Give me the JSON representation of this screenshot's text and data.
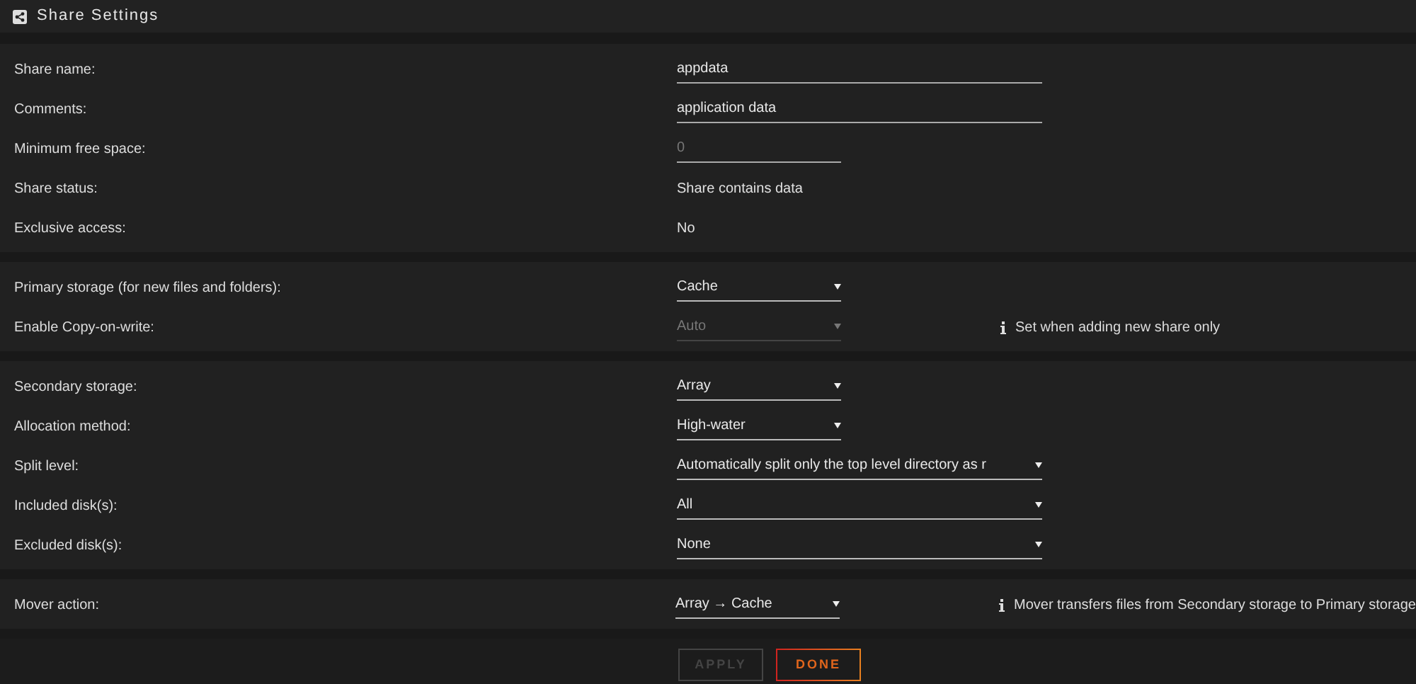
{
  "header": {
    "title": "Share Settings"
  },
  "sections": [
    {
      "rows": [
        {
          "label": "Share name:",
          "kind": "text",
          "value": "appdata",
          "wide": true
        },
        {
          "label": "Comments:",
          "kind": "text",
          "value": "application data",
          "wide": true
        },
        {
          "label": "Minimum free space:",
          "kind": "text",
          "placeholder": "0",
          "wide": false
        },
        {
          "label": "Share status:",
          "kind": "static",
          "value": "Share contains data"
        },
        {
          "label": "Exclusive access:",
          "kind": "static",
          "value": "No"
        }
      ]
    },
    {
      "rows": [
        {
          "label": "Primary storage (for new files and folders):",
          "kind": "select",
          "value": "Cache",
          "wide": false,
          "disabled": false
        },
        {
          "label": "Enable Copy-on-write:",
          "kind": "select",
          "value": "Auto",
          "wide": false,
          "disabled": true,
          "info": "Set when adding new share only"
        }
      ]
    },
    {
      "rows": [
        {
          "label": "Secondary storage:",
          "kind": "select",
          "value": "Array",
          "wide": false,
          "disabled": false
        },
        {
          "label": "Allocation method:",
          "kind": "select",
          "value": "High-water",
          "wide": false,
          "disabled": false
        },
        {
          "label": "Split level:",
          "kind": "select",
          "value": "Automatically split only the top level directory as r",
          "wide": true,
          "disabled": false
        },
        {
          "label": "Included disk(s):",
          "kind": "select",
          "value": "All",
          "wide": true,
          "disabled": false
        },
        {
          "label": "Excluded disk(s):",
          "kind": "select",
          "value": "None",
          "wide": true,
          "disabled": false
        }
      ]
    },
    {
      "rows": [
        {
          "label": "Mover action:",
          "kind": "select",
          "value": "Array → Cache",
          "wide": false,
          "disabled": false,
          "info": "Mover transfers files from Secondary storage to Primary storage"
        }
      ]
    }
  ],
  "buttons": [
    {
      "label": "APPLY",
      "kind": "apply",
      "disabled": true
    },
    {
      "label": "DONE",
      "kind": "done",
      "disabled": false
    }
  ]
}
